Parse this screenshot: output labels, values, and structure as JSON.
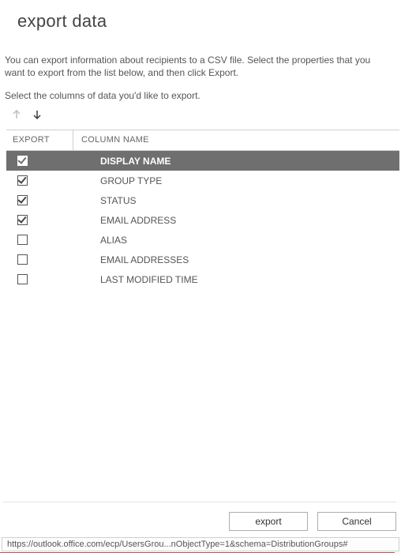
{
  "title": "export data",
  "instructions": "You can export information about recipients to a CSV file. Select the properties that you want to export from the list below, and then click Export.",
  "subhead": "Select the columns of data you'd like to export.",
  "columns_header": {
    "export": "EXPORT",
    "name": "COLUMN NAME"
  },
  "rows": [
    {
      "label": "DISPLAY NAME",
      "checked": true,
      "selected": true
    },
    {
      "label": "GROUP TYPE",
      "checked": true,
      "selected": false
    },
    {
      "label": "STATUS",
      "checked": true,
      "selected": false
    },
    {
      "label": "EMAIL ADDRESS",
      "checked": true,
      "selected": false
    },
    {
      "label": "ALIAS",
      "checked": false,
      "selected": false
    },
    {
      "label": "EMAIL ADDRESSES",
      "checked": false,
      "selected": false
    },
    {
      "label": "LAST MODIFIED TIME",
      "checked": false,
      "selected": false
    }
  ],
  "buttons": {
    "export": "export",
    "cancel": "Cancel"
  },
  "status_url": "https://outlook.office.com/ecp/UsersGrou...nObjectType=1&schema=DistributionGroups#"
}
